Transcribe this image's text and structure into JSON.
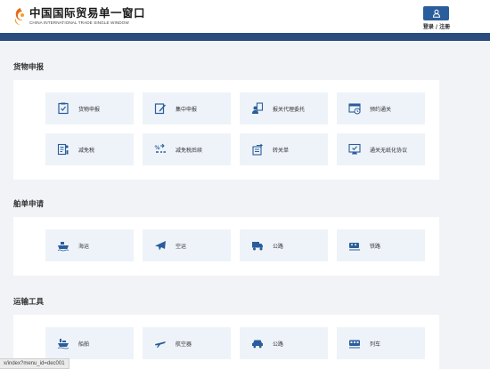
{
  "header": {
    "logo_cn": "中国国际贸易单一窗口",
    "logo_en": "CHINA INTERNATIONAL TRADE SINGLE WINDOW",
    "login_label": "登录 / 注册"
  },
  "sections": [
    {
      "title": "货物申报",
      "tiles": [
        {
          "label": "货物申报",
          "icon": "declaration-icon"
        },
        {
          "label": "集中申报",
          "icon": "batch-declare-icon"
        },
        {
          "label": "报关代理委托",
          "icon": "agent-icon"
        },
        {
          "label": "预约通关",
          "icon": "appointment-icon"
        },
        {
          "label": "减免税",
          "icon": "tax-exempt-icon"
        },
        {
          "label": "减免税后续",
          "icon": "tax-followup-icon"
        },
        {
          "label": "转关单",
          "icon": "transfer-icon"
        },
        {
          "label": "通关无纸化协议",
          "icon": "paperless-icon"
        }
      ]
    },
    {
      "title": "舶单申请",
      "tiles": [
        {
          "label": "海运",
          "icon": "ship-icon"
        },
        {
          "label": "空运",
          "icon": "plane-icon"
        },
        {
          "label": "公路",
          "icon": "truck-icon"
        },
        {
          "label": "铁路",
          "icon": "train-icon"
        }
      ]
    },
    {
      "title": "运输工具",
      "tiles": [
        {
          "label": "船舶",
          "icon": "vessel-icon"
        },
        {
          "label": "航空器",
          "icon": "aircraft-icon"
        },
        {
          "label": "公路",
          "icon": "road-vehicle-icon"
        },
        {
          "label": "列车",
          "icon": "locomotive-icon"
        }
      ]
    }
  ],
  "status_url": "x/index?menu_id=dec001",
  "colors": {
    "brand": "#2b4c7e",
    "icon": "#2a5d9c",
    "tile_bg": "#eef3f9"
  }
}
